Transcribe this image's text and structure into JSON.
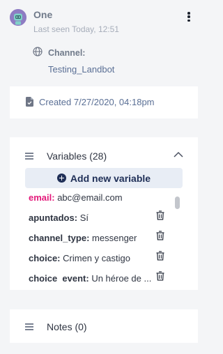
{
  "header": {
    "user_name": "One",
    "last_seen": "Last seen Today, 12:51",
    "channel_label": "Channel:",
    "channel_value": "Testing_Landbot"
  },
  "created": {
    "text": "Created 7/27/2020, 04:18pm"
  },
  "variables": {
    "title": "Variables (28)",
    "add_button_label": "Add new variable",
    "items": [
      {
        "key": "email:",
        "value": "abc@email.com"
      },
      {
        "key": "apuntados:",
        "value": "Sí"
      },
      {
        "key": "channel_type:",
        "value": "messenger"
      },
      {
        "key": "choice:",
        "value": "Crimen y castigo"
      },
      {
        "key": "choice_event:",
        "value": "Un héroe de ..."
      }
    ]
  },
  "notes": {
    "title": "Notes (0)"
  },
  "icons": {
    "avatar": "robot-avatar-icon",
    "menu": "more-vertical-icon",
    "channel": "globe-icon",
    "created": "document-icon",
    "section": "hamburger-icon",
    "collapse": "chevron-up-icon",
    "add": "plus-circle-icon",
    "delete": "trash-icon"
  },
  "colors": {
    "highlight_key": "#e3197a",
    "button_bg": "#e8edf5",
    "button_text": "#1f2f57",
    "link_text": "#5a6f95"
  }
}
